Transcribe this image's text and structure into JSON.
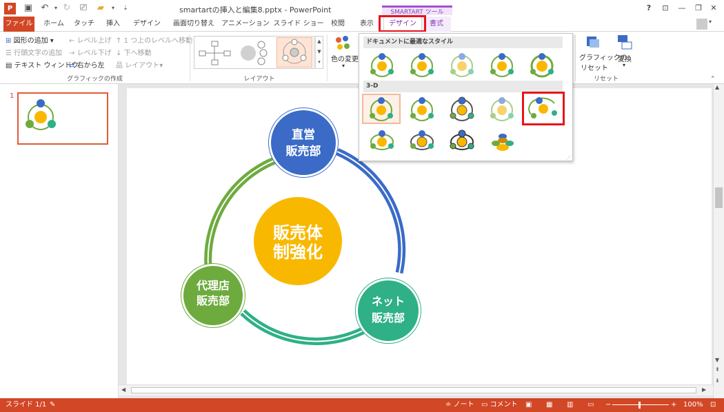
{
  "titlebar": {
    "doc_title": "smartartの挿入と編集8.pptx - PowerPoint",
    "app_logo": "P",
    "help": "?",
    "window_controls": [
      "ribbon-display-icon",
      "minimize-icon",
      "restore-icon",
      "close-icon"
    ]
  },
  "tabs": {
    "file": "ファイル",
    "items": [
      "ホーム",
      "タッチ",
      "挿入",
      "デザイン",
      "画面切り替え",
      "アニメーション",
      "スライド ショー",
      "校閲",
      "表示"
    ],
    "context_group": "SMARTART ツール",
    "design": "デザイン",
    "format": "書式"
  },
  "ribbon": {
    "create": {
      "add_shape": "図形の追加",
      "add_bullet": "行頭文字の追加",
      "text_pane": "テキスト ウィンドウ",
      "promote": "レベル上げ",
      "demote": "レベル下げ",
      "rtl": "右から左",
      "move_up": "1 つ上のレベルへ移動",
      "move_down": "下へ移動",
      "layout": "レイアウト",
      "label": "グラフィックの作成"
    },
    "layouts_label": "レイアウト",
    "change_colors": "色の変更",
    "reset_graphic_line1": "グラフィックの",
    "reset_graphic_line2": "リセット",
    "convert": "変換",
    "reset_label": "リセット"
  },
  "styles_gallery": {
    "section1": "ドキュメントに最適なスタイル",
    "section2": "3-D"
  },
  "slide_panel": {
    "slide_number": "1",
    "thumb_text": "販売体制強化"
  },
  "slide": {
    "center_line1": "販売体",
    "center_line2": "制強化",
    "top_line1": "直営",
    "top_line2": "販売部",
    "left_line1": "代理店",
    "left_line2": "販売部",
    "right_line1": "ネット",
    "right_line2": "販売部"
  },
  "status": {
    "slide_info": "スライド 1/1",
    "notes": "ノート",
    "comments": "コメント",
    "zoom": "100%"
  },
  "colors": {
    "accent": "#d24726",
    "center": "#f9b800",
    "blue": "#3b6bc7",
    "green": "#6eab3e",
    "teal": "#2fb087",
    "context": "#8a3fb8",
    "highlight": "#e8131b"
  }
}
